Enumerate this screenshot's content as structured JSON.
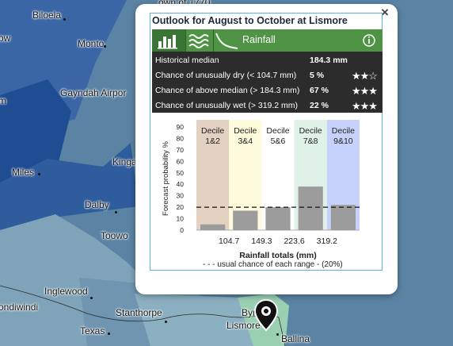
{
  "map": {
    "places": [
      {
        "id": "town-of-1770",
        "label": "own of 1770"
      },
      {
        "id": "biloela",
        "label": "Biloela"
      },
      {
        "id": "monto",
        "label": "Monto"
      },
      {
        "id": "gayndah-airport",
        "label": "Gayndah Airpor"
      },
      {
        "id": "miles",
        "label": "Miles"
      },
      {
        "id": "kingaroy",
        "label": "Kinga"
      },
      {
        "id": "dalby",
        "label": "Dalby"
      },
      {
        "id": "toowoomba",
        "label": "Toowo"
      },
      {
        "id": "inglewood",
        "label": "Inglewood"
      },
      {
        "id": "goondiwindi",
        "label": "ondiwindi"
      },
      {
        "id": "stanthorpe",
        "label": "Stanthorpe"
      },
      {
        "id": "texas",
        "label": "Texas"
      },
      {
        "id": "byron-bay",
        "label": "Byr"
      },
      {
        "id": "lismore",
        "label": "Lismore"
      },
      {
        "id": "ballina",
        "label": "Ballina"
      },
      {
        "id": "edge-ow",
        "label": "ow"
      },
      {
        "id": "edge-m",
        "label": "m"
      }
    ]
  },
  "popup": {
    "close": "×",
    "title": "Outlook for August to October at Lismore",
    "toolbar": {
      "rainfall": "Rainfall"
    },
    "stats": [
      {
        "label": "Historical median",
        "value": "184.3 mm",
        "stars": 0
      },
      {
        "label": "Chance of unusually dry (< 104.7 mm)",
        "value": "5 %",
        "stars": 2
      },
      {
        "label": "Chance of above median (> 184.3 mm)",
        "value": "67 %",
        "stars": 3
      },
      {
        "label": "Chance of unusually wet (> 319.2 mm)",
        "value": "22 %",
        "stars": 3
      }
    ],
    "legend": "- - - usual chance of each range - (20%)"
  },
  "chart_data": {
    "type": "bar",
    "categories": [
      "Decile 1&2",
      "Decile 3&4",
      "Decile 5&6",
      "Decile 7&8",
      "Decile 9&10"
    ],
    "category_lines": [
      [
        "Decile",
        "1&2"
      ],
      [
        "Decile",
        "3&4"
      ],
      [
        "Decile",
        "5&6"
      ],
      [
        "Decile",
        "7&8"
      ],
      [
        "Decile",
        "9&10"
      ]
    ],
    "values": [
      5,
      17,
      20,
      38,
      22
    ],
    "band_colors": [
      "#e3d1c2",
      "#fdfbdb",
      "#ffffff",
      "#e0f2e8",
      "#c6d2fb"
    ],
    "bar_color": "#9c9c9c",
    "reference_value": 20,
    "ylabel": "Forecast probability %",
    "xlabel": "Rainfall totals (mm)",
    "ylim": [
      0,
      90
    ],
    "yticks": [
      0,
      10,
      20,
      30,
      40,
      50,
      60,
      70,
      80,
      90
    ],
    "boundary_labels": [
      "104.7",
      "149.3",
      "223.6",
      "319.2"
    ]
  }
}
